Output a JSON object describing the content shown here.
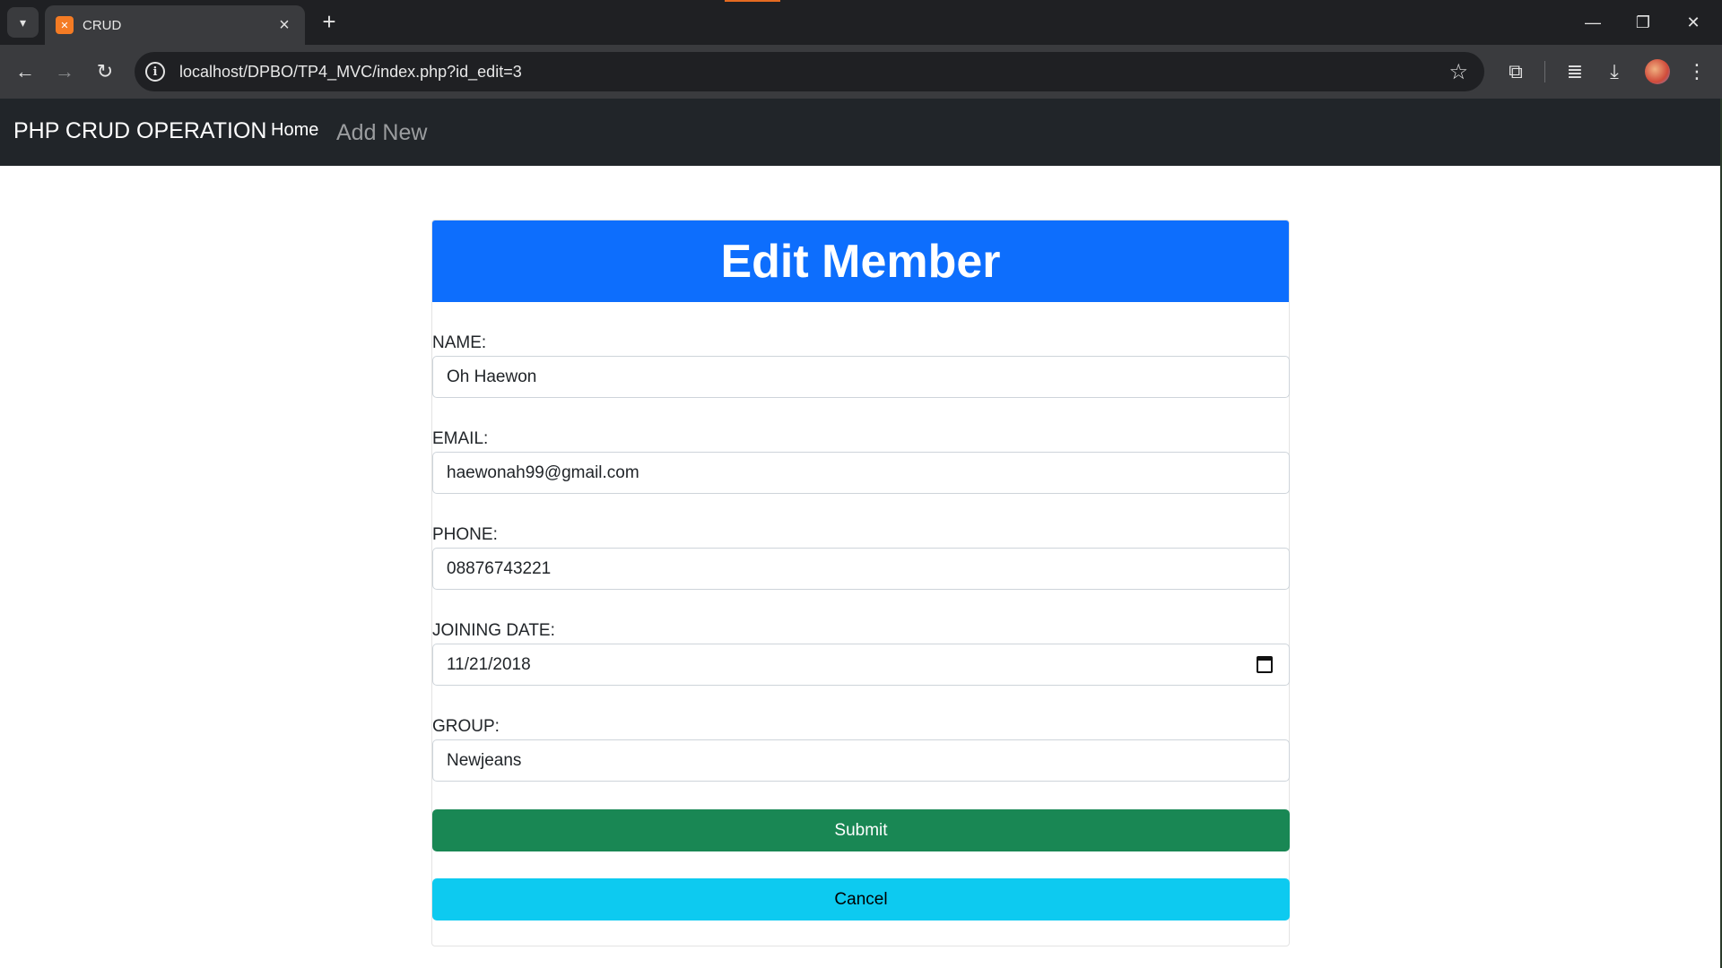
{
  "browser": {
    "tab_title": "CRUD",
    "favicon_text": "✕",
    "url": "localhost/DPBO/TP4_MVC/index.php?id_edit=3"
  },
  "navbar": {
    "brand": "PHP CRUD OPERATION",
    "links": [
      {
        "label": "Home"
      },
      {
        "label": "Add New"
      }
    ]
  },
  "form": {
    "title": "Edit Member",
    "fields": [
      {
        "label": "NAME:",
        "value": "Oh Haewon"
      },
      {
        "label": "EMAIL:",
        "value": "haewonah99@gmail.com"
      },
      {
        "label": "PHONE:",
        "value": "08876743221"
      },
      {
        "label": "JOINING DATE:",
        "value": "11/21/2018"
      },
      {
        "label": "GROUP:",
        "value": "Newjeans"
      }
    ],
    "submit_label": "Submit",
    "cancel_label": "Cancel"
  },
  "colors": {
    "header_blue": "#0d6efd",
    "submit_green": "#198754",
    "cancel_cyan": "#0dcaf0",
    "navbar_dark": "#212529"
  }
}
